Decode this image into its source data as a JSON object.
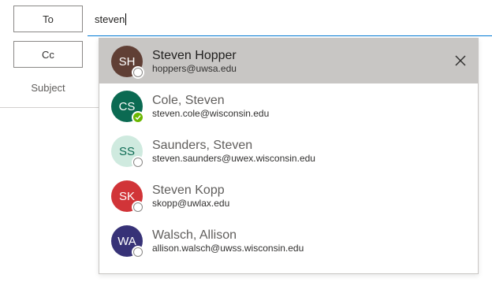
{
  "recipients": {
    "to_label": "To",
    "cc_label": "Cc",
    "subject_label": "Subject",
    "to_value": "steven"
  },
  "suggestions": [
    {
      "initials": "SH",
      "name": "Steven Hopper",
      "email": "hoppers@uwsa.edu",
      "avatar_color": "#603f35",
      "initials_color": "#ffffff",
      "presence": "offline",
      "selected": true
    },
    {
      "initials": "CS",
      "name": "Cole, Steven",
      "email": "steven.cole@wisconsin.edu",
      "avatar_color": "#0b6a52",
      "initials_color": "#ffffff",
      "presence": "available",
      "selected": false
    },
    {
      "initials": "SS",
      "name": "Saunders, Steven",
      "email": "steven.saunders@uwex.wisconsin.edu",
      "avatar_color": "#cfeadf",
      "initials_color": "#0b6a52",
      "presence": "offline",
      "selected": false
    },
    {
      "initials": "SK",
      "name": "Steven Kopp",
      "email": "skopp@uwlax.edu",
      "avatar_color": "#d13438",
      "initials_color": "#ffffff",
      "presence": "offline",
      "selected": false
    },
    {
      "initials": "WA",
      "name": "Walsch, Allison",
      "email": "allison.walsch@uwss.wisconsin.edu",
      "avatar_color": "#373277",
      "initials_color": "#ffffff",
      "presence": "offline",
      "selected": false
    }
  ],
  "colors": {
    "accent": "#0078d4",
    "selected_row": "#c8c6c4",
    "presence_available": "#6bb700"
  },
  "icons": {
    "remove_suggestion": "close-icon",
    "presence_available": "checkmark-icon"
  }
}
